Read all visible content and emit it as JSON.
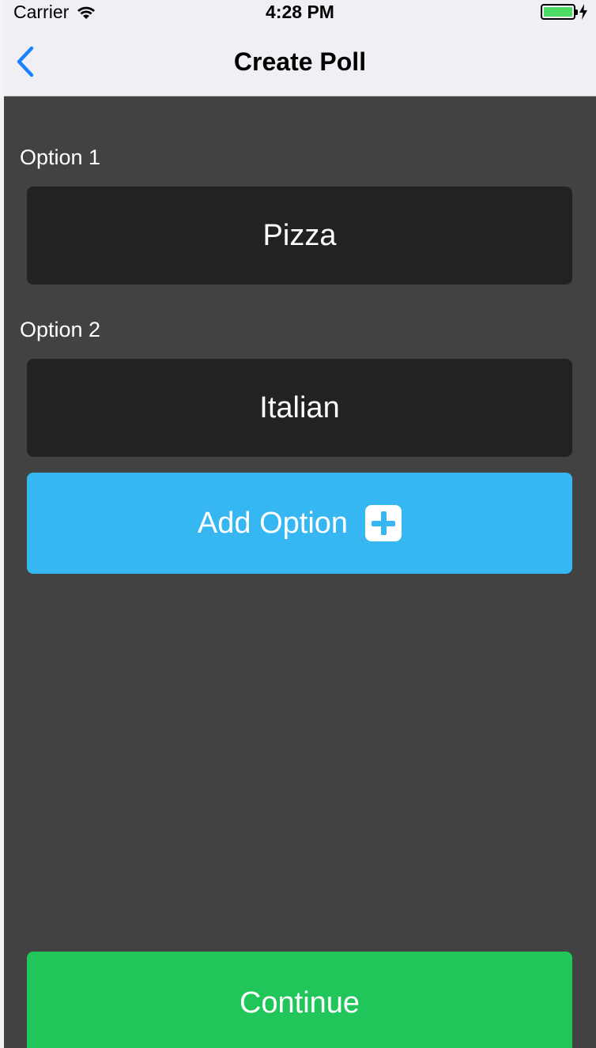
{
  "status_bar": {
    "carrier": "Carrier",
    "time": "4:28 PM",
    "wifi_icon": "wifi-icon",
    "battery_icon": "battery-icon",
    "battery_color": "#4cd964"
  },
  "nav": {
    "title": "Create Poll",
    "back_icon": "chevron-left-icon",
    "back_color": "#1a82fb"
  },
  "options": [
    {
      "label": "Option 1",
      "value": "Pizza"
    },
    {
      "label": "Option 2",
      "value": "Italian"
    }
  ],
  "add_option": {
    "label": "Add Option",
    "icon": "plus-square-icon",
    "color": "#36b7f1"
  },
  "continue": {
    "label": "Continue",
    "color": "#20c659"
  }
}
